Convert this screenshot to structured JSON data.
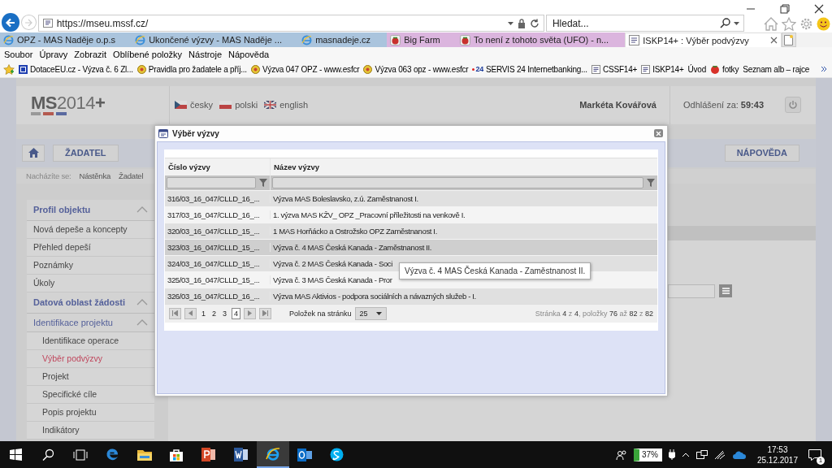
{
  "browser": {
    "address": "https://mseu.mssf.cz/",
    "search": {
      "placeholder": "Hledat..."
    },
    "tabs": [
      {
        "label": "OPZ - MAS Naděje o.p.s",
        "kind": "ie",
        "color": "#aac4dd",
        "selected": false
      },
      {
        "label": "Ukončené výzvy - MAS Naděje ...",
        "kind": "ie",
        "color": "#aac4dd",
        "selected": false
      },
      {
        "label": "masnadeje.cz",
        "kind": "ie",
        "color": "#aac4dd",
        "selected": false
      },
      {
        "label": "Big Farm",
        "kind": "game",
        "color": "#dbb5de",
        "selected": false
      },
      {
        "label": "To není z tohoto světa (UFO) - n...",
        "kind": "game",
        "color": "#dbb5de",
        "selected": false
      },
      {
        "label": "ISKP14+ : Výběr podvýzvy",
        "kind": "page",
        "color": "#ffffff",
        "selected": true
      }
    ],
    "menu": [
      "Soubor",
      "Úpravy",
      "Zobrazit",
      "Oblíbené položky",
      "Nástroje",
      "Nápověda"
    ],
    "favorites": [
      {
        "label": "DotaceEU.cz - Výzva č. 6 Zl...",
        "kind": "eu"
      },
      {
        "label": "Pravidla pro žadatele a příj...",
        "kind": "coin"
      },
      {
        "label": "Výzva 047 OPZ - www.esfcr",
        "kind": "coin"
      },
      {
        "label": "Výzva 063 opz - www.esfcr",
        "kind": "coin"
      },
      {
        "label": "SERVIS 24 Internetbanking...",
        "kind": "servis",
        "badge": "24"
      },
      {
        "label": "CSSF14+",
        "kind": "page"
      },
      {
        "label": "ISKP14+",
        "kind": "page"
      },
      {
        "label": "Úvod",
        "kind": "plain"
      },
      {
        "label": "fotky",
        "kind": "tomato"
      },
      {
        "label": "Seznam alb – rajce",
        "kind": "plain"
      }
    ]
  },
  "header": {
    "logo": "**MS**2014**+**",
    "languages": [
      {
        "label": "česky",
        "kind": "cz"
      },
      {
        "label": "polski",
        "kind": "pl"
      },
      {
        "label": "english",
        "kind": "gb"
      }
    ],
    "user": "Markéta Kovářová",
    "logout_label": "Odhlášení za:",
    "logout_time": "59:43"
  },
  "nav": {
    "buttons": [
      "ŽADATEL"
    ],
    "help": "NÁPOVĚDA"
  },
  "breadcrumb": {
    "label": "Nacházíte se:",
    "items": [
      "Nástěnka",
      "Žadatel"
    ]
  },
  "sidebar": {
    "sections": [
      {
        "title": "Profil objektu",
        "expanded": true,
        "items": [
          {
            "label": "Nová depeše a koncepty",
            "selected": false
          },
          {
            "label": "Přehled depeší",
            "selected": false
          },
          {
            "label": "Poznámky",
            "selected": false
          },
          {
            "label": "Úkoly",
            "selected": false
          }
        ]
      },
      {
        "title": "Datová oblast žádosti",
        "expanded": true,
        "children": [
          {
            "title": "Identifikace projektu",
            "expanded": true,
            "items": [
              {
                "label": "Identifikace operace",
                "selected": false
              },
              {
                "label": "Výběr podvýzvy",
                "selected": true
              },
              {
                "label": "Projekt",
                "selected": false
              },
              {
                "label": "Specifické cíle",
                "selected": false
              },
              {
                "label": "Popis projektu",
                "selected": false
              },
              {
                "label": "Indikátory",
                "selected": false
              }
            ]
          }
        ]
      }
    ]
  },
  "dialog": {
    "title": "Výběr výzvy",
    "columns": [
      "Číslo výzvy",
      "Název výzvy"
    ],
    "rows": [
      {
        "cells": [
          "316/03_16_047/CLLD_16_...",
          "Výzva MAS Boleslavsko, z.ú. Zaměstnanost I."
        ],
        "highlighted": false
      },
      {
        "cells": [
          "317/03_16_047/CLLD_16_...",
          "1. výzva MAS KŽV_ OPZ _Pracovní příležitosti na venkově I."
        ],
        "highlighted": false
      },
      {
        "cells": [
          "320/03_16_047/CLLD_15_...",
          "1 MAS Horňácko a Ostrožsko OPZ Zaměstnanost I."
        ],
        "highlighted": false
      },
      {
        "cells": [
          "323/03_16_047/CLLD_15_...",
          "Výzva č. 4 MAS Česká Kanada - Zaměstnanost II."
        ],
        "highlighted": true
      },
      {
        "cells": [
          "324/03_16_047/CLLD_15_...",
          "Výzva č. 2 MAS Česká Kanada - Soci"
        ],
        "highlighted": false
      },
      {
        "cells": [
          "325/03_16_047/CLLD_15_...",
          "Výzva č. 3 MAS Česká Kanada - Pror"
        ],
        "highlighted": false
      },
      {
        "cells": [
          "326/03_16_047/CLLD_16_...",
          "Výzva MAS Aktivios - podpora sociálních a návazných služeb - I."
        ],
        "highlighted": false
      }
    ],
    "pager": {
      "pages": [
        {
          "label": "1",
          "selected": false
        },
        {
          "label": "2",
          "selected": false
        },
        {
          "label": "3",
          "selected": false
        },
        {
          "label": "4",
          "selected": true
        }
      ],
      "page_size_label": "Položek na stránku",
      "page_size": "25",
      "summary": "Stránka **4** z **4**, položky **76** až **82** z **82**"
    },
    "tooltip": "Výzva č. 4 MAS Česká Kanada - Zaměstnanost II."
  },
  "taskbar": {
    "apps": [
      {
        "kind": "start",
        "active": false
      },
      {
        "kind": "search",
        "active": false
      },
      {
        "kind": "taskview",
        "active": false
      },
      {
        "kind": "edge",
        "active": false
      },
      {
        "kind": "explorer",
        "active": false
      },
      {
        "kind": "store",
        "active": false
      },
      {
        "kind": "powerpoint",
        "active": false
      },
      {
        "kind": "word",
        "active": false
      },
      {
        "kind": "ie",
        "active": true
      },
      {
        "kind": "outlook",
        "active": false
      },
      {
        "kind": "skype",
        "active": false
      }
    ],
    "battery": "37%",
    "time": "17:53",
    "date": "25.12.2017",
    "notifications": "1"
  }
}
